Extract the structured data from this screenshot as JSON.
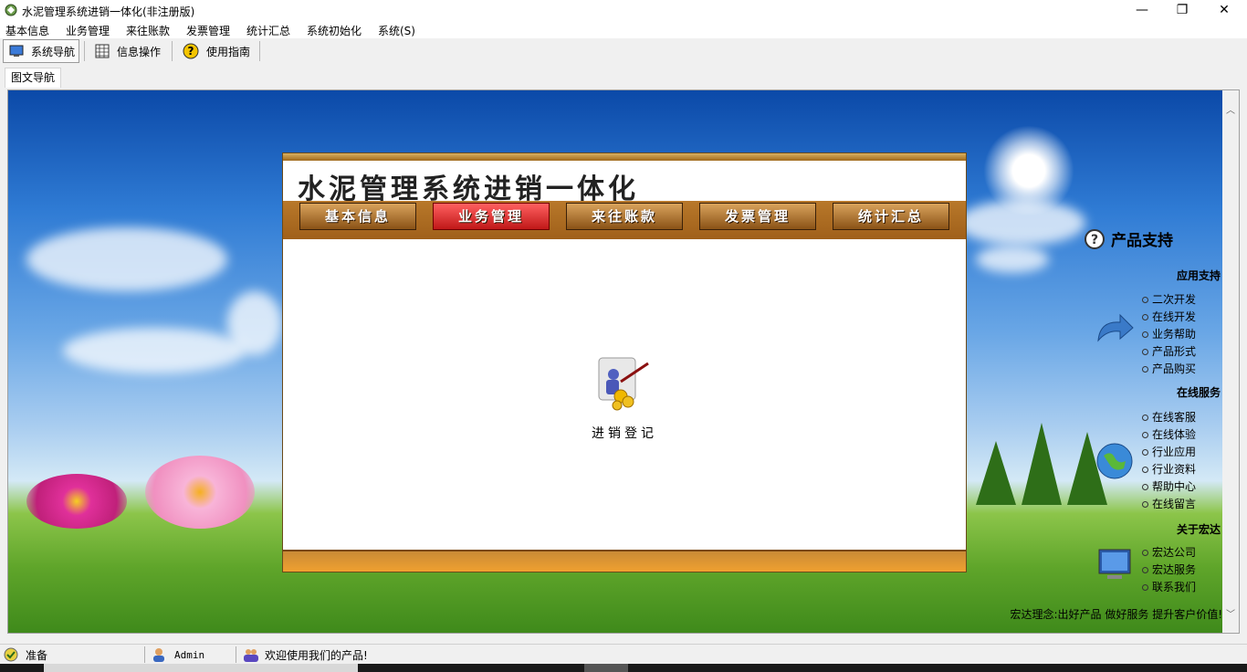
{
  "window": {
    "title": "水泥管理系统进销一体化(非注册版)",
    "minimize": "—",
    "maximize": "❐",
    "close": "✕"
  },
  "menu": [
    "基本信息",
    "业务管理",
    "来往账款",
    "发票管理",
    "统计汇总",
    "系统初始化",
    "系统(S)"
  ],
  "toolbar": {
    "nav": "系统导航",
    "info": "信息操作",
    "guide": "使用指南"
  },
  "tab": {
    "label": "图文导航"
  },
  "panel": {
    "title": "水泥管理系统进销一体化",
    "nav": [
      "基本信息",
      "业务管理",
      "来往账款",
      "发票管理",
      "统计汇总"
    ],
    "active_index": 1,
    "item_label": "进销登记"
  },
  "support": {
    "title": "产品支持",
    "sections": [
      {
        "title": "应用支持",
        "items": [
          "二次开发",
          "在线开发",
          "业务帮助",
          "产品形式",
          "产品购买"
        ]
      },
      {
        "title": "在线服务",
        "items": [
          "在线客服",
          "在线体验",
          "行业应用",
          "行业资料",
          "帮助中心",
          "在线留言"
        ]
      },
      {
        "title": "关于宏达",
        "items": [
          "宏达公司",
          "宏达服务",
          "联系我们"
        ]
      }
    ],
    "slogan": "宏达理念:出好产品 做好服务 提升客户价值!"
  },
  "status": {
    "state": "准备",
    "user": "Admin",
    "message": "欢迎使用我们的产品!"
  },
  "colors": {
    "accent": "#a0601a",
    "active": "#c01818"
  }
}
